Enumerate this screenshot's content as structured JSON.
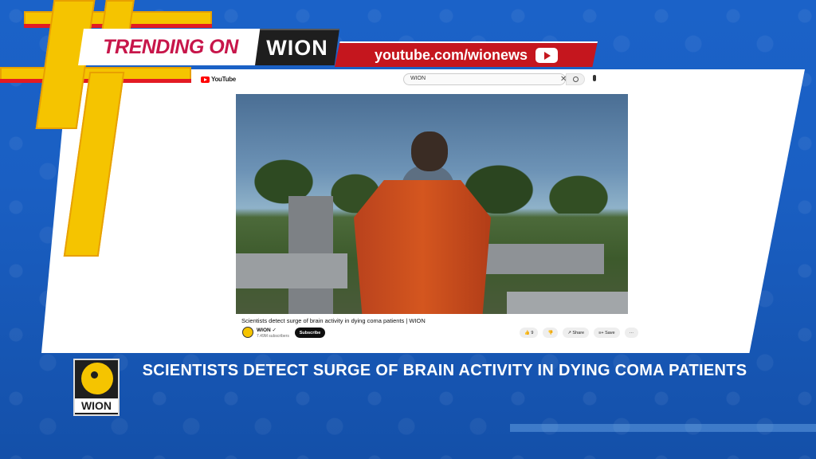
{
  "overlay": {
    "trending_label": "TRENDING ON",
    "brand": "WION",
    "youtube_url": "youtube.com/wionews"
  },
  "youtube": {
    "logo_text": "YouTube",
    "search_value": "WION",
    "search_clear": "✕",
    "video_title": "Scientists detect surge of brain activity in dying coma patients | WION",
    "channel_name": "WION ✓",
    "channel_subs": "7.49M subscribers",
    "subscribe_label": "Subscribe",
    "like_count": "👍 9",
    "dislike": "👎",
    "share_label": "↗ Share",
    "save_label": "≡+ Save",
    "more_label": "···"
  },
  "lower_third": {
    "logo_text": "WION",
    "headline": "SCIENTISTS DETECT SURGE OF BRAIN ACTIVITY IN DYING COMA PATIENTS"
  },
  "colors": {
    "background_blue": "#1b62c8",
    "accent_yellow": "#f5c400",
    "accent_red": "#c5161e",
    "trending_pink": "#c7164a"
  }
}
